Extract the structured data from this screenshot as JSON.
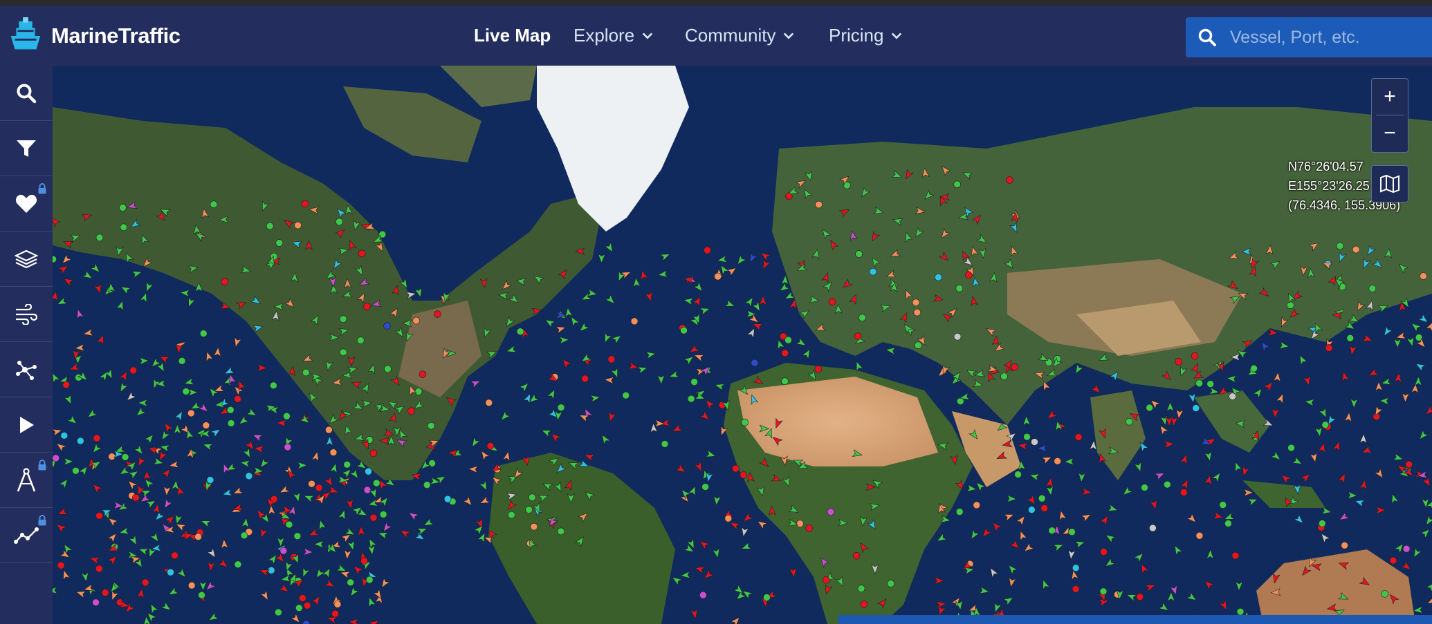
{
  "app": {
    "name": "MarineTraffic"
  },
  "nav": {
    "items": [
      {
        "label": "Live Map",
        "active": true,
        "dropdown": false
      },
      {
        "label": "Explore",
        "active": false,
        "dropdown": true
      },
      {
        "label": "Community",
        "active": false,
        "dropdown": true
      },
      {
        "label": "Pricing",
        "active": false,
        "dropdown": true
      }
    ]
  },
  "search": {
    "placeholder": "Vessel, Port, etc.",
    "value": "",
    "icon": "search-icon"
  },
  "sidebar": {
    "items": [
      {
        "name": "search",
        "icon": "search-icon",
        "locked": false
      },
      {
        "name": "filter",
        "icon": "filter-icon",
        "locked": false
      },
      {
        "name": "favorites",
        "icon": "heart-icon",
        "locked": true
      },
      {
        "name": "layers",
        "icon": "layers-icon",
        "locked": false
      },
      {
        "name": "weather",
        "icon": "wind-icon",
        "locked": false
      },
      {
        "name": "density",
        "icon": "network-icon",
        "locked": false
      },
      {
        "name": "playback",
        "icon": "play-icon",
        "locked": false
      },
      {
        "name": "measure",
        "icon": "compass-icon",
        "locked": true
      },
      {
        "name": "routes",
        "icon": "route-icon",
        "locked": true
      }
    ]
  },
  "map": {
    "coordinates": {
      "lat": "N76°26'04.57",
      "lon": "E155°23'26.25",
      "decimal": "(76.4346, 155.3906)"
    },
    "zoom_in_label": "+",
    "zoom_out_label": "−",
    "vessel_colors": {
      "cargo": "#3ec84a",
      "tanker": "#e5141f",
      "fishing": "#f4905a",
      "passenger": "#2ec3e6",
      "pleasure": "#c94fd0",
      "unknown": "#c8c8c8",
      "tug": "#2b4bd0"
    }
  },
  "colors": {
    "header_bg": "#232e5e",
    "accent": "#1c5cb8"
  }
}
